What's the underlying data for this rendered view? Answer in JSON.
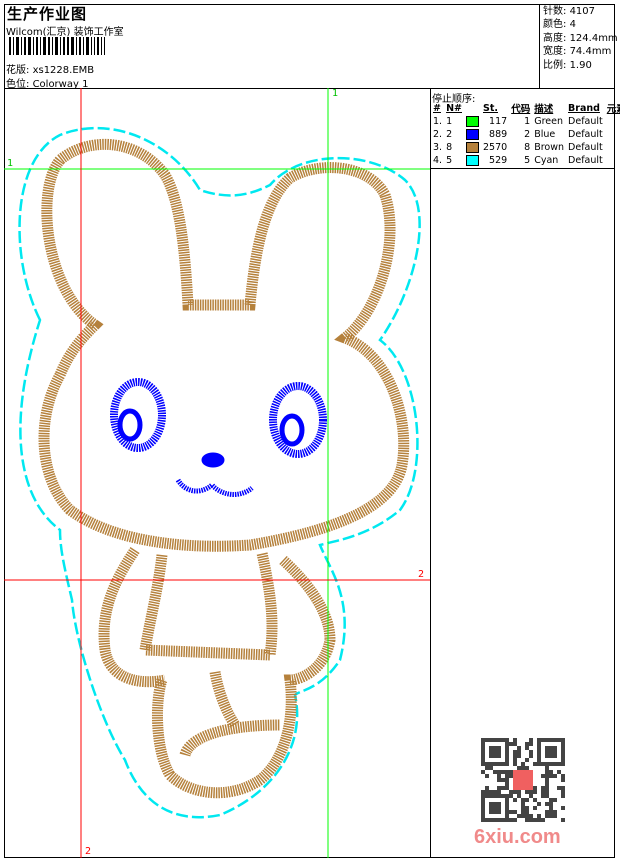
{
  "header": {
    "title": "生产作业图",
    "company": "Wilcom(汇京) 装饰工作室",
    "design_label": "花版:",
    "design_value": "xs1228.EMB",
    "colorway_label": "色位:",
    "colorway_value": "Colorway 1"
  },
  "info": {
    "stitches_label": "针数:",
    "stitches_value": "4107",
    "colors_label": "颜色:",
    "colors_value": "4",
    "height_label": "高度:",
    "height_value": "124.4mm",
    "width_label": "宽度:",
    "width_value": "74.4mm",
    "scale_label": "比例:",
    "scale_value": "1.90"
  },
  "stop_sequence": {
    "title": "停止顺序:",
    "columns": [
      "#",
      "N#",
      "St.",
      "代码",
      "描述",
      "Brand",
      "元素"
    ],
    "rows": [
      {
        "idx": "1.",
        "n": "1",
        "color": "#00ff00",
        "st": "117",
        "code": "1",
        "desc": "Green",
        "brand": "Default"
      },
      {
        "idx": "2.",
        "n": "2",
        "color": "#0000ff",
        "st": "889",
        "code": "2",
        "desc": "Blue",
        "brand": "Default"
      },
      {
        "idx": "3.",
        "n": "8",
        "color": "#b5813c",
        "st": "2570",
        "code": "8",
        "desc": "Brown",
        "brand": "Default"
      },
      {
        "idx": "4.",
        "n": "5",
        "color": "#00ffff",
        "st": "529",
        "code": "5",
        "desc": "Cyan",
        "brand": "Default"
      }
    ]
  },
  "guides": {
    "green_v": "1",
    "green_h": "1",
    "red_h": "2",
    "red_v": "2"
  },
  "watermark": "6xiu.com",
  "colors": {
    "brown": "#b5813c",
    "blue": "#0000ff",
    "cyan": "#00ffff",
    "green": "#00ff00",
    "red": "#ff0000"
  }
}
